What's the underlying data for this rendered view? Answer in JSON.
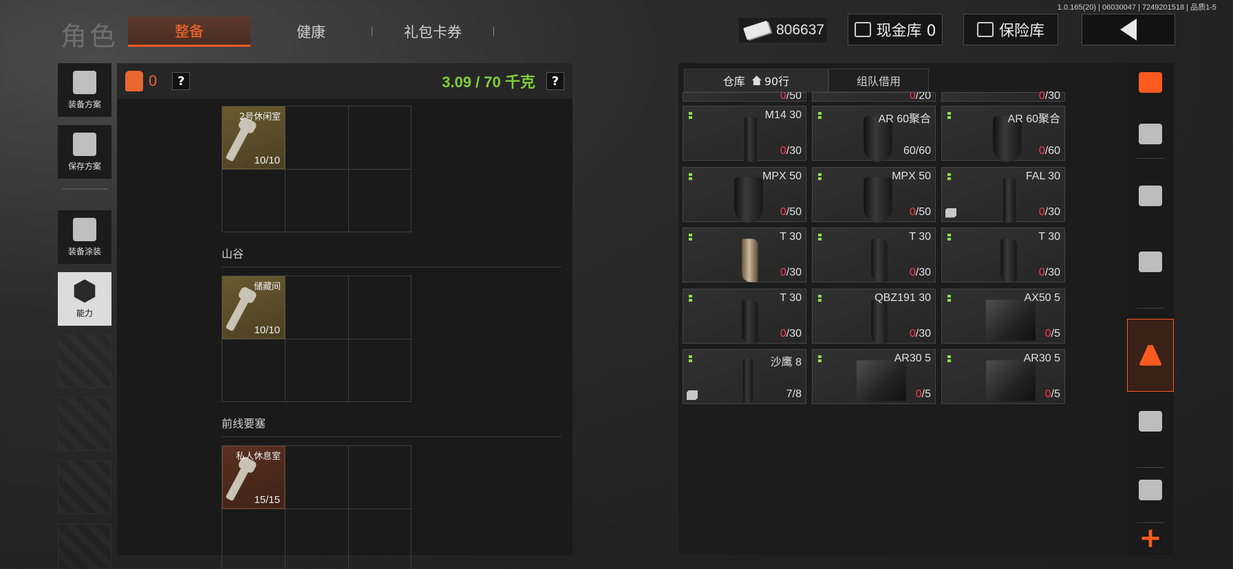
{
  "version": "1.0.165(20) | 06030047 | 7249201518 | 品质1-5",
  "page_title": "角色",
  "tabs": [
    {
      "label": "整备",
      "active": true
    },
    {
      "label": "健康",
      "active": false
    },
    {
      "label": "礼包卡券",
      "active": false
    }
  ],
  "currency": {
    "amount": "806637",
    "icon": "banknote-icon"
  },
  "cash_vault": {
    "label": "现金库 0",
    "icon": "vault-icon"
  },
  "safe_box": {
    "label": "保险库",
    "icon": "safe-icon"
  },
  "left_nav": [
    {
      "label": "装备方案",
      "icon": "vest-loadout-icon"
    },
    {
      "label": "保存方案",
      "icon": "download-icon"
    },
    {
      "label": "装备涂装",
      "icon": "helmet-paint-icon"
    },
    {
      "label": "能力",
      "icon": "ability-icon",
      "selected": true
    }
  ],
  "equipment": {
    "count": "0",
    "help": "?",
    "weight": "3.09 / 70 千克",
    "help2": "?",
    "keys": [
      {
        "section": "",
        "name": "2号休闲室",
        "count": "10/10",
        "color": "gold"
      },
      {
        "section": "山谷",
        "name": "储藏间",
        "count": "10/10",
        "color": "gold"
      },
      {
        "section": "前线要塞",
        "name": "私人休息室",
        "count": "15/15",
        "color": "brown"
      }
    ]
  },
  "storage": {
    "tab_warehouse": "仓库",
    "rows": "90行",
    "tab_team": "组队借用",
    "top_partial": [
      {
        "cur": "0",
        "max": "/50"
      },
      {
        "cur": "0",
        "max": "/20"
      },
      {
        "cur": "0",
        "max": "/30"
      }
    ],
    "items": [
      {
        "name": "M14 30",
        "cur": "0",
        "max": "/30",
        "mag": "straight",
        "full": false,
        "box": false
      },
      {
        "name": "AR 60聚合",
        "cur": "60",
        "max": "/60",
        "mag": "drum",
        "full": true,
        "box": false
      },
      {
        "name": "AR 60聚合",
        "cur": "0",
        "max": "/60",
        "mag": "drum",
        "full": false,
        "box": false
      },
      {
        "name": "MPX 50",
        "cur": "0",
        "max": "/50",
        "mag": "drum",
        "full": false,
        "box": false
      },
      {
        "name": "MPX 50",
        "cur": "0",
        "max": "/50",
        "mag": "drum",
        "full": false,
        "box": false
      },
      {
        "name": "FAL 30",
        "cur": "0",
        "max": "/30",
        "mag": "straight",
        "full": false,
        "box": true
      },
      {
        "name": "T 30",
        "cur": "0",
        "max": "/30",
        "mag": "curved tan",
        "full": false,
        "box": false
      },
      {
        "name": "T 30",
        "cur": "0",
        "max": "/30",
        "mag": "curved",
        "full": false,
        "box": false
      },
      {
        "name": "T 30",
        "cur": "0",
        "max": "/30",
        "mag": "curved",
        "full": false,
        "box": false
      },
      {
        "name": "T 30",
        "cur": "0",
        "max": "/30",
        "mag": "curved",
        "full": false,
        "box": false
      },
      {
        "name": "QBZ191 30",
        "cur": "0",
        "max": "/30",
        "mag": "curved",
        "full": false,
        "box": false
      },
      {
        "name": "AX50 5",
        "cur": "0",
        "max": "/5",
        "mag": "box",
        "full": false,
        "box": false
      },
      {
        "name": "沙鹰 8",
        "cur": "7",
        "max": "/8",
        "mag": "pistol",
        "full": true,
        "box": true
      },
      {
        "name": "AR30 5",
        "cur": "0",
        "max": "/5",
        "mag": "box",
        "full": false,
        "box": false
      },
      {
        "name": "AR30 5",
        "cur": "0",
        "max": "/5",
        "mag": "box",
        "full": false,
        "box": false
      }
    ]
  },
  "right_nav": [
    {
      "icon": "restack-icon"
    },
    {
      "icon": "home-icon"
    },
    {
      "icon": "helmet-icon"
    },
    {
      "icon": "rifle-icon"
    },
    {
      "icon": "magazine-icon",
      "active": true
    },
    {
      "icon": "ammo-icon"
    },
    {
      "icon": "scope-icon"
    }
  ],
  "add": "+",
  "colors": {
    "accent": "#ff5a1f",
    "weight_green": "#7fce3a",
    "empty_red": "#ff3a4e"
  }
}
